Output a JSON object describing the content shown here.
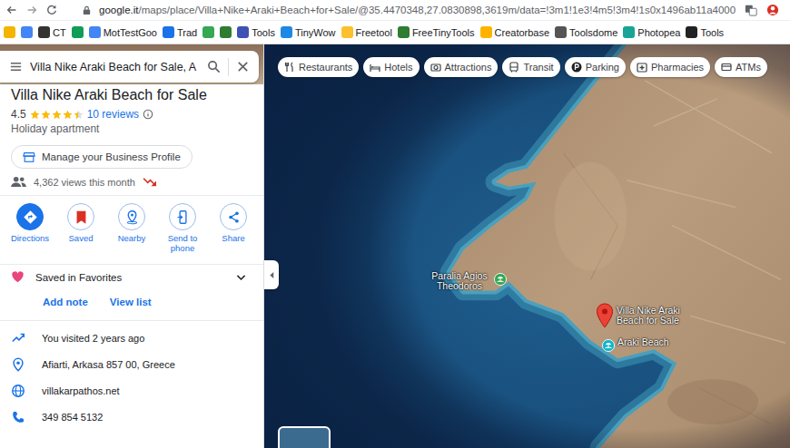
{
  "browser": {
    "url_host": "google.it",
    "url_path": "/maps/place/Villa+Nike+Araki+Beach+for+Sale/@35.4470348,27.0830898,3619m/data=!3m1!1e3!4m5!3m4!1s0x1496ab11a4000",
    "bookmarks": [
      {
        "color": "#f4b400"
      },
      {
        "color": "#4285f4"
      },
      {
        "label": "CT",
        "color": "#333333"
      },
      {
        "color": "#0f9d58"
      },
      {
        "label": "MotTestGoo",
        "color": "#4285f4"
      },
      {
        "label": "Trad",
        "color": "#1a73e8"
      },
      {
        "color": "#34a853"
      },
      {
        "color": "#2e7d32"
      },
      {
        "label": "Tools",
        "color": "#3f51b5"
      },
      {
        "label": "TinyWow",
        "color": "#1e88e5"
      },
      {
        "label": "Freetool",
        "color": "#fbc02d"
      },
      {
        "label": "FreeTinyTools",
        "color": "#2e7d32"
      },
      {
        "label": "Creatorbase",
        "color": "#ffb300"
      },
      {
        "label": "Toolsdome",
        "color": "#555555"
      },
      {
        "label": "Photopea",
        "color": "#18a497"
      },
      {
        "label": "Tools",
        "color": "#222222"
      }
    ]
  },
  "search": {
    "value": "Villa Nike Araki Beach for Sale, A"
  },
  "place": {
    "title": "Villa Nike Araki Beach for Sale",
    "rating": "4.5",
    "stars": 4.5,
    "reviews": "10 reviews",
    "type": "Holiday apartment",
    "manage": "Manage your Business Profile",
    "views": "4,362 views this month"
  },
  "actions": [
    {
      "label": "Directions",
      "primary": true,
      "on": false
    },
    {
      "label": "Saved",
      "primary": false,
      "on": true
    },
    {
      "label": "Nearby",
      "primary": false,
      "on": false
    },
    {
      "label": "Send to phone",
      "primary": false,
      "on": false
    },
    {
      "label": "Share",
      "primary": false,
      "on": false
    }
  ],
  "saved": {
    "list": "Saved in Favorites",
    "add_note": "Add note",
    "view_list": "View list"
  },
  "info": [
    {
      "text": "You visited 2 years ago"
    },
    {
      "text": "Afiarti, Arkasa 857 00, Greece"
    },
    {
      "text": "villakarpathos.net"
    },
    {
      "text": "349 854 5132"
    }
  ],
  "chips": [
    {
      "label": "Restaurants"
    },
    {
      "label": "Hotels"
    },
    {
      "label": "Attractions"
    },
    {
      "label": "Transit"
    },
    {
      "label": "Parking"
    },
    {
      "label": "Pharmacies"
    },
    {
      "label": "ATMs"
    }
  ],
  "map": {
    "places": [
      {
        "name": "Paralia Agios Theodoros",
        "kind": "beach"
      },
      {
        "name": "Villa Nike Araki Beach for Sale",
        "kind": "pin"
      },
      {
        "name": "Araki Beach",
        "kind": "beach"
      }
    ]
  }
}
